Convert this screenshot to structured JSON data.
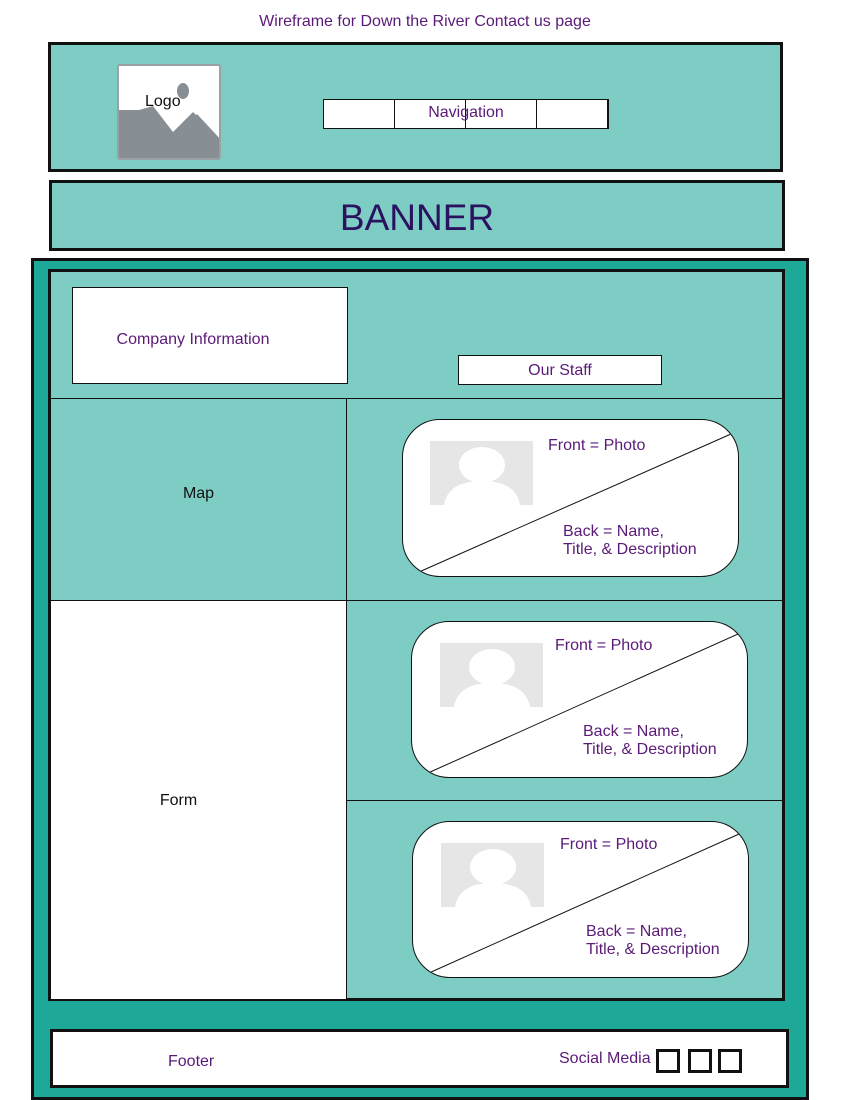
{
  "page_title": "Wireframe for Down the River Contact us page",
  "header": {
    "logo_label": "Logo",
    "logo_icon": "image-placeholder-icon",
    "nav_label": "Navigation"
  },
  "banner": {
    "label": "BANNER"
  },
  "content": {
    "company_info": "Company Information",
    "our_staff": "Our Staff",
    "map": "Map",
    "form": "Form",
    "staff_cards": [
      {
        "front": "Front = Photo",
        "back_line1": "Back = Name,",
        "back_line2": "Title, & Description",
        "photo_icon": "person-placeholder-icon"
      },
      {
        "front": "Front = Photo",
        "back_line1": "Back = Name,",
        "back_line2": "Title, & Description",
        "photo_icon": "person-placeholder-icon"
      },
      {
        "front": "Front = Photo",
        "back_line1": "Back = Name,",
        "back_line2": "Title, & Description",
        "photo_icon": "person-placeholder-icon"
      }
    ]
  },
  "footer": {
    "label": "Footer",
    "social_label": "Social Media"
  },
  "colors": {
    "teal_light": "#7ecdc4",
    "teal_dark": "#1ea897",
    "text_purple": "#5a1a78",
    "banner_text": "#2b1260"
  }
}
